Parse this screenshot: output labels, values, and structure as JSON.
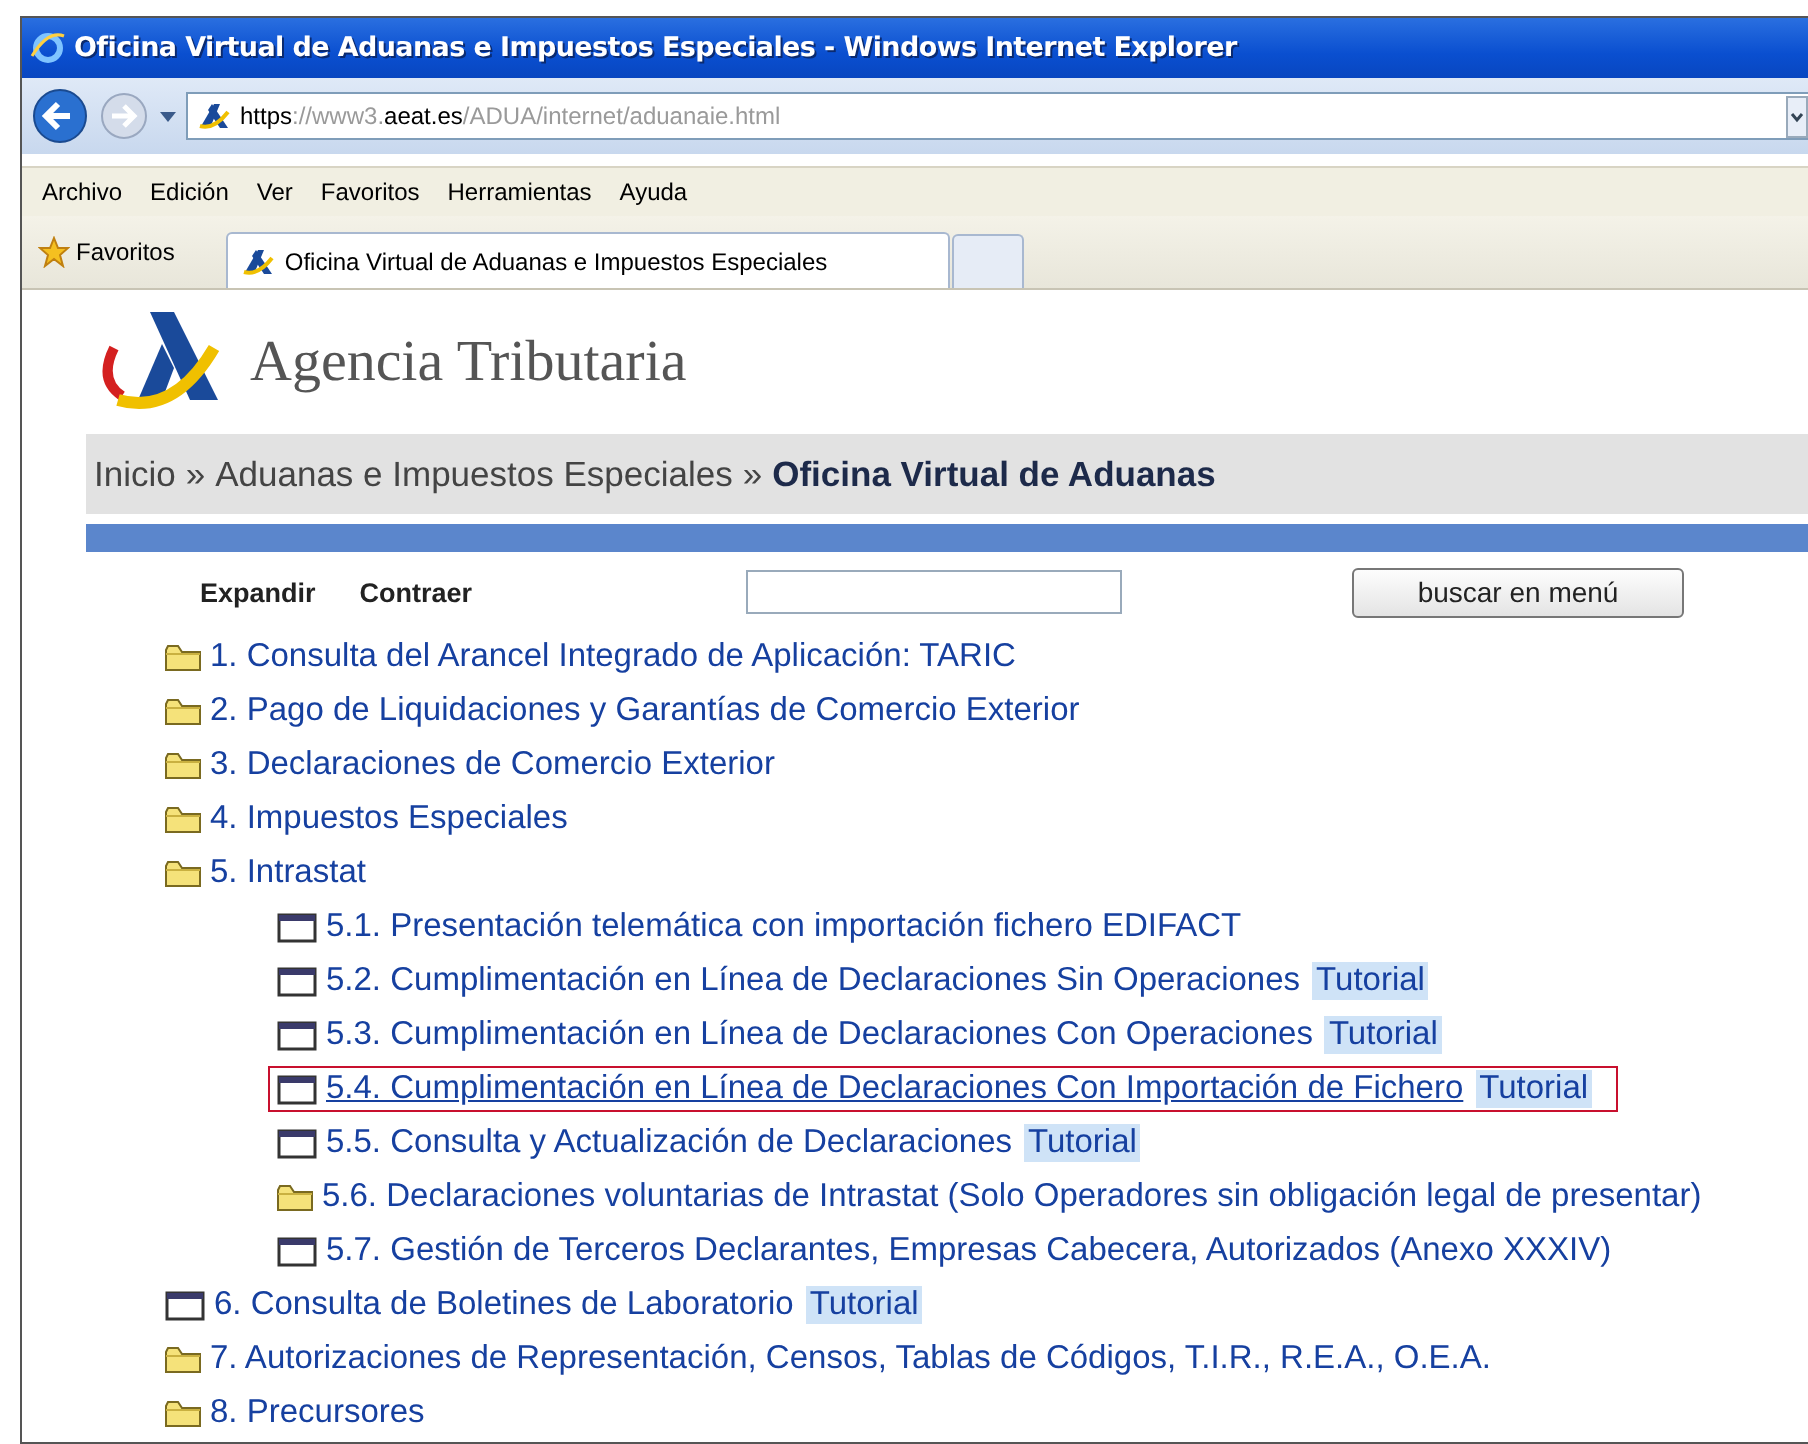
{
  "window": {
    "title": "Oficina Virtual de Aduanas e Impuestos Especiales - Windows Internet Explorer"
  },
  "address_bar": {
    "url_parts": [
      {
        "text": "https",
        "strong": true
      },
      {
        "text": "://www3.",
        "strong": false
      },
      {
        "text": "aeat.es",
        "strong": true
      },
      {
        "text": "/ADUA/internet/aduanaie.html",
        "strong": false
      }
    ]
  },
  "menu_bar": [
    "Archivo",
    "Edición",
    "Ver",
    "Favoritos",
    "Herramientas",
    "Ayuda"
  ],
  "favorites_bar": {
    "label": "Favoritos",
    "tabs": [
      {
        "label": "Oficina Virtual de Aduanas e Impuestos Especiales",
        "selected": true
      }
    ]
  },
  "page": {
    "site_name": "Agencia Tributaria",
    "breadcrumb": [
      {
        "text": "Inicio",
        "current": false
      },
      {
        "text": "Aduanas e Impuestos Especiales",
        "current": false
      },
      {
        "text": "Oficina Virtual de Aduanas",
        "current": true
      }
    ],
    "breadcrumb_separator": "»",
    "tree_controls": [
      "Expandir",
      "Contraer"
    ],
    "search_button": "buscar en menú",
    "menu": [
      {
        "kind": "folder",
        "label": "1. Consulta del Arancel Integrado de Aplicación: TARIC",
        "selected": false
      },
      {
        "kind": "folder",
        "label": "2. Pago de Liquidaciones y Garantías de Comercio Exterior",
        "selected": false
      },
      {
        "kind": "folder",
        "label": "3. Declaraciones de Comercio Exterior",
        "selected": false
      },
      {
        "kind": "folder",
        "label": "4. Impuestos Especiales",
        "selected": false
      },
      {
        "kind": "folder",
        "label": "5. Intrastat",
        "selected": false,
        "children": [
          {
            "kind": "page",
            "label": "5.1. Presentación telemática con importación fichero EDIFACT",
            "selected": false
          },
          {
            "kind": "page",
            "label": "5.2. Cumplimentación en Línea de Declaraciones Sin Operaciones",
            "tutorial": "Tutorial",
            "selected": false
          },
          {
            "kind": "page",
            "label": "5.3. Cumplimentación en Línea de Declaraciones Con Operaciones",
            "tutorial": "Tutorial",
            "selected": false
          },
          {
            "kind": "page",
            "label": "5.4. Cumplimentación en Línea de Declaraciones Con Importación de Fichero",
            "tutorial": "Tutorial",
            "selected": true
          },
          {
            "kind": "page",
            "label": "5.5. Consulta y Actualización de Declaraciones",
            "tutorial": "Tutorial",
            "selected": false
          },
          {
            "kind": "folder",
            "label": "5.6. Declaraciones voluntarias de Intrastat (Solo Operadores sin obligación legal de presentar)",
            "selected": false
          },
          {
            "kind": "page",
            "label": "5.7. Gestión de Terceros Declarantes, Empresas Cabecera, Autorizados (Anexo XXXIV)",
            "selected": false
          }
        ]
      },
      {
        "kind": "page",
        "label": "6. Consulta de Boletines de Laboratorio",
        "tutorial": "Tutorial",
        "selected": false
      },
      {
        "kind": "folder",
        "label": "7. Autorizaciones de Representación, Censos, Tablas de Códigos, T.I.R., R.E.A., O.E.A.",
        "selected": false
      },
      {
        "kind": "folder",
        "label": "8. Precursores",
        "selected": false
      }
    ]
  }
}
